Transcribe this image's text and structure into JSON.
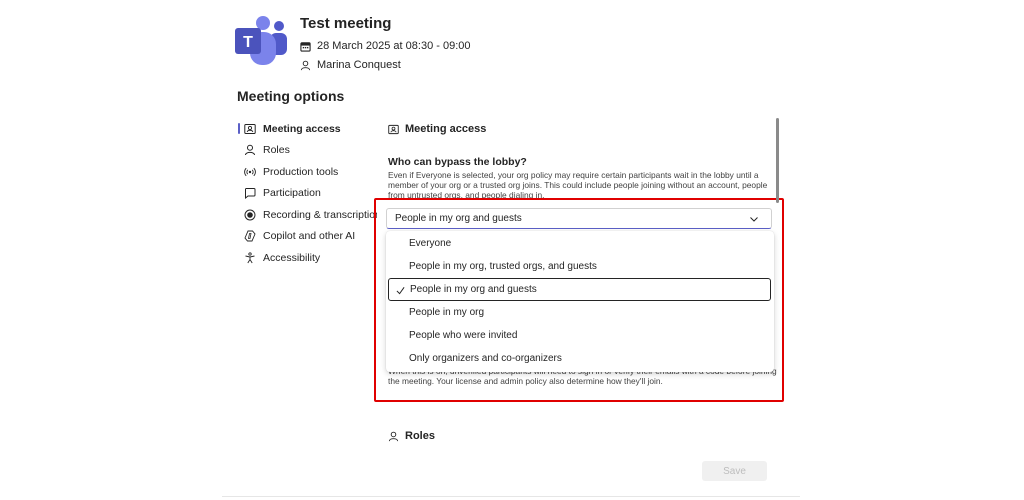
{
  "meeting": {
    "title": "Test meeting",
    "datetime": "28 March 2025 at 08:30 - 09:00",
    "organizer": "Marina Conquest"
  },
  "app": {
    "logo_letter": "T",
    "brand_color": "#5b5fc7",
    "logo_color": "#4b53bc"
  },
  "options": {
    "heading": "Meeting options",
    "nav": [
      {
        "label": "Meeting access",
        "icon": "meeting-access-icon",
        "active": true
      },
      {
        "label": "Roles",
        "icon": "person-icon"
      },
      {
        "label": "Production tools",
        "icon": "broadcast-icon"
      },
      {
        "label": "Participation",
        "icon": "chat-icon"
      },
      {
        "label": "Recording & transcription",
        "icon": "record-icon"
      },
      {
        "label": "Copilot and other AI",
        "icon": "copilot-icon"
      },
      {
        "label": "Accessibility",
        "icon": "accessibility-icon"
      }
    ]
  },
  "access": {
    "section_title": "Meeting access",
    "lobby_question": "Who can bypass the lobby?",
    "lobby_description": "Even if Everyone is selected, your org policy may require certain participants wait in the lobby until a member of your org or a trusted org joins. This could include people joining without an account, people from untrusted orgs, and people dialing in.",
    "selected_value": "People in my org and guests",
    "dropdown_options": [
      {
        "label": "Everyone",
        "selected": false
      },
      {
        "label": "People in my org, trusted orgs, and guests",
        "selected": false
      },
      {
        "label": "People in my org and guests",
        "selected": true
      },
      {
        "label": "People in my org",
        "selected": false
      },
      {
        "label": "People who were invited",
        "selected": false
      },
      {
        "label": "Only organizers and co-organizers",
        "selected": false
      }
    ],
    "verify_description": "When this is on, unverified participants will need to sign in or verify their emails with a code before joining the meeting. Your license and admin policy also determine how they'll join."
  },
  "roles": {
    "section_title": "Roles"
  },
  "footer": {
    "save_label": "Save"
  },
  "highlight_color": "#e00000"
}
